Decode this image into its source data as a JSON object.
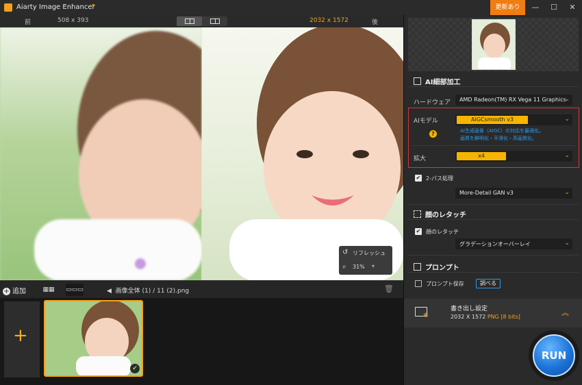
{
  "app": {
    "title": "Aiarty Image Enhancer",
    "update_label": "更新あり"
  },
  "compare": {
    "before_label": "前",
    "original_size": "508 x 393",
    "output_size": "2032 x 1572",
    "after_label": "後"
  },
  "zoom": {
    "refresh_label": "リフレッシュ",
    "zoom_value": "31%"
  },
  "list_bar": {
    "add_label": "追加",
    "path_all": "画像全体 (1)",
    "path_separator": "/",
    "file_name": "11 (2).png"
  },
  "panel": {
    "ai_section_title": "AI細部加工",
    "hardware_label": "ハードウェア",
    "hardware_value": "AMD Radeon(TM) RX Vega 11 Graphics",
    "ai_model_label": "AIモデル",
    "ai_model_value": "AIGCsmooth  v3",
    "help_glyph": "?",
    "ai_model_desc_1": "AI生成画像（AIGC）の対応を最適化。",
    "ai_model_desc_2": "画質を鮮明化・平滑化・高画質化。",
    "upscale_label": "拡大",
    "upscale_value": "x4",
    "two_pass_label": "2-パス処理",
    "two_pass_model": "More-Detail GAN  v3",
    "face_section_title": "顔のレタッチ",
    "face_check_label": "顔のレタッチ",
    "face_mode": "グラデーションオーバーレイ",
    "prompt_section_title": "プロンプト",
    "prompt_save_label": "プロンプト保存",
    "prompt_check_button": "調べる"
  },
  "export": {
    "title": "書き出し設定",
    "size": "2032 X 1572",
    "format": "PNG",
    "bits": "[8 bits]"
  },
  "run": {
    "label": "RUN"
  },
  "colors": {
    "accent": "#f3a11b",
    "highlight_frame": "#e0303c",
    "link_blue": "#2c9cf0"
  }
}
